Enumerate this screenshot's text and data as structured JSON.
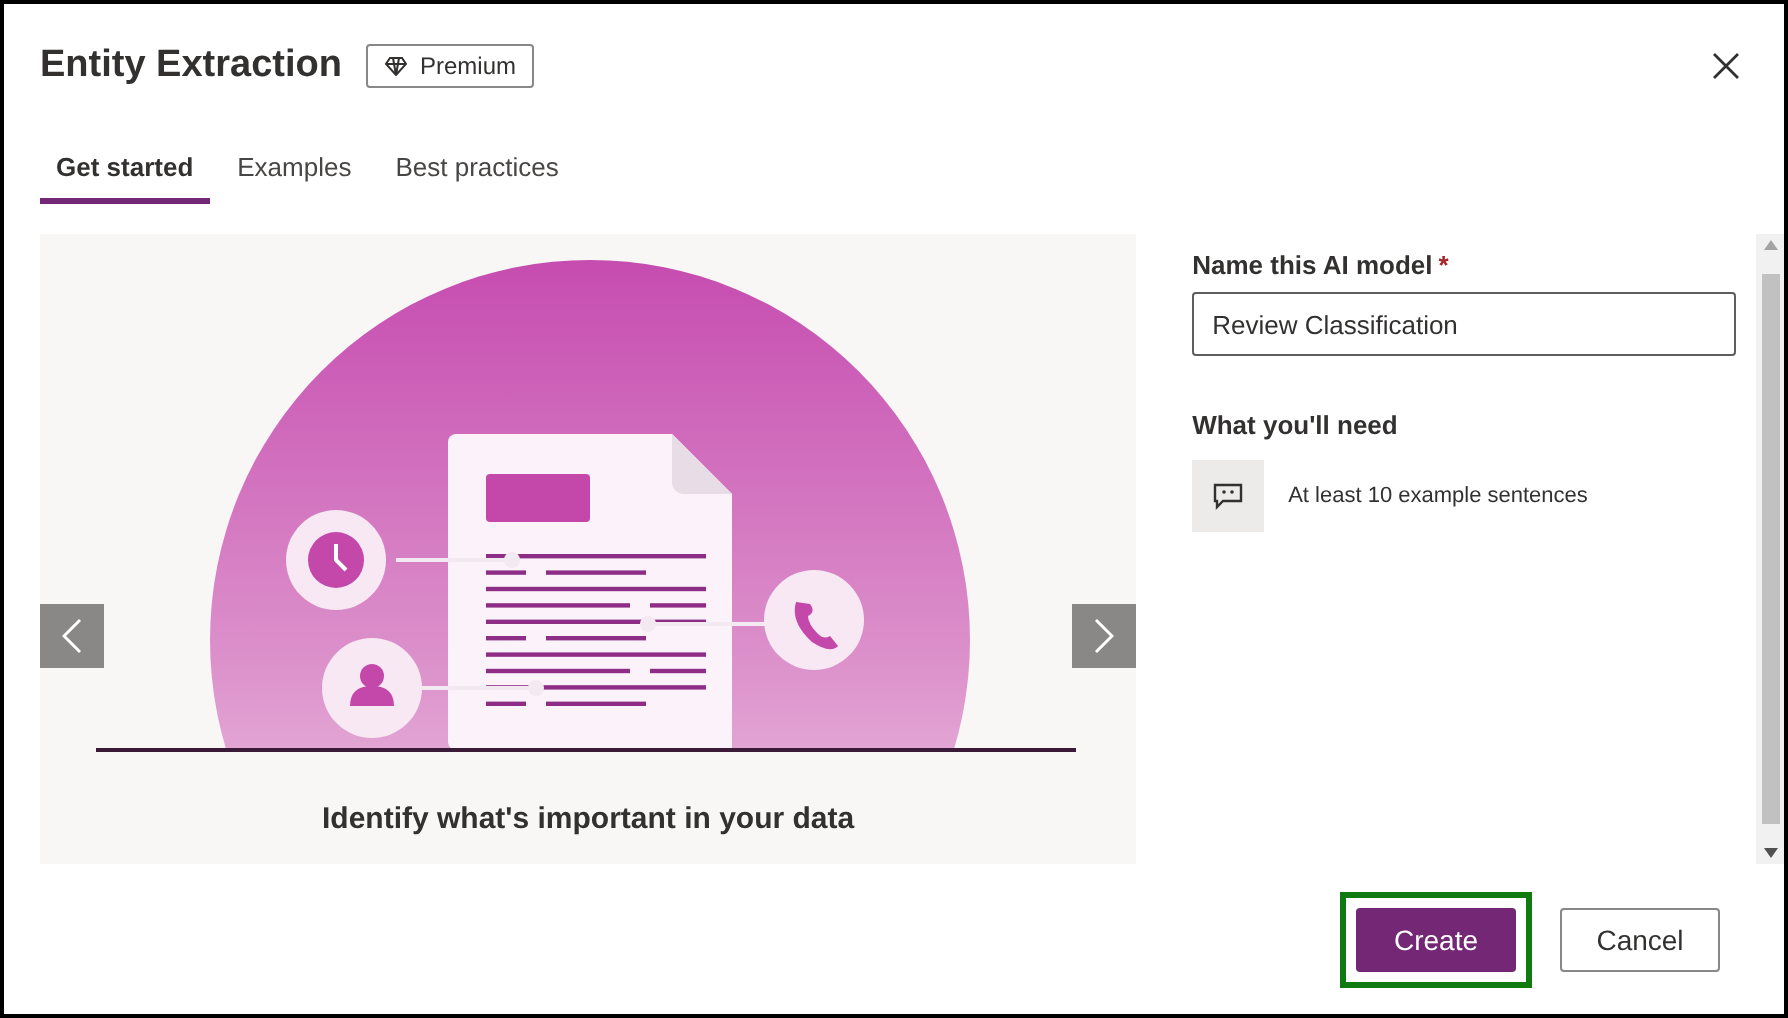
{
  "dialog": {
    "title": "Entity Extraction",
    "badge": "Premium",
    "tabs": [
      {
        "label": "Get started",
        "selected": true
      },
      {
        "label": "Examples",
        "selected": false
      },
      {
        "label": "Best practices",
        "selected": false
      }
    ],
    "carousel": {
      "heading": "Identify what's important in your data"
    },
    "form": {
      "label": "Name this AI model",
      "required_mark": "*",
      "value": "Review Classification"
    },
    "needs": {
      "heading": "What you'll need",
      "items": [
        {
          "text": "At least 10 example sentences"
        }
      ]
    },
    "buttons": [
      {
        "label": "Create",
        "kind": "primary",
        "highlighted": true
      },
      {
        "label": "Cancel",
        "kind": "secondary",
        "highlighted": false
      }
    ]
  }
}
